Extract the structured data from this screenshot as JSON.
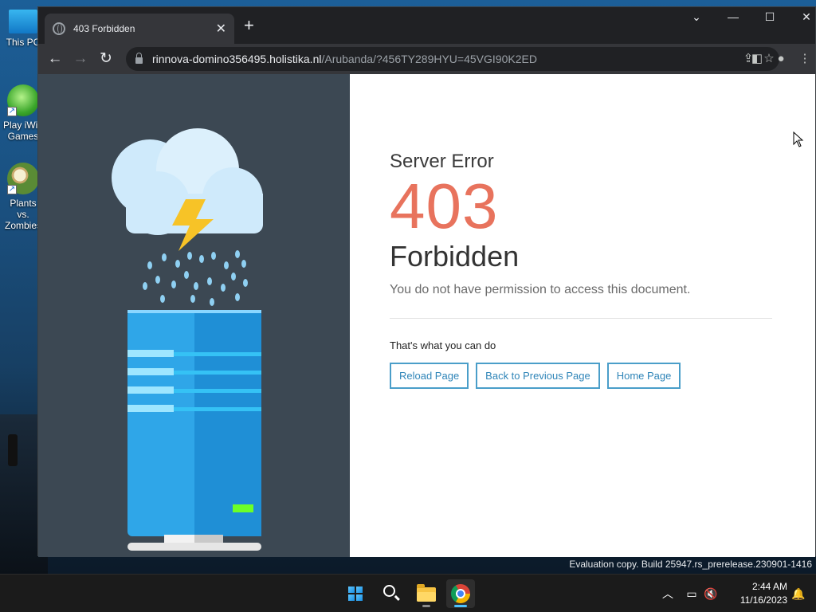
{
  "desktop": {
    "icons": [
      {
        "label": "This PC"
      },
      {
        "label": "Play iWin Games"
      },
      {
        "label": "Plants vs. Zombies"
      }
    ]
  },
  "browser": {
    "tab": {
      "title": "403 Forbidden"
    },
    "window_controls": {
      "dropdown": "⌄",
      "minimize": "—",
      "maximize": "☐",
      "close": "✕"
    },
    "omnibox": {
      "host": "rinnova-domino356495.holistika.nl",
      "path": "/Arubanda/?456TY289HYU=45VGI90K2ED"
    }
  },
  "page": {
    "error_label": "Server Error",
    "error_code": "403",
    "error_title": "Forbidden",
    "error_message": "You do not have permission to access this document.",
    "suggestion": "That's what you can do",
    "buttons": {
      "reload": "Reload Page",
      "back": "Back to Previous Page",
      "home": "Home Page"
    },
    "colors": {
      "error_code": "#e8735d",
      "panel_bg": "#3c4853",
      "button_border": "#4a9ec9"
    }
  },
  "watermark": "Evaluation copy. Build 25947.rs_prerelease.230901-1416",
  "taskbar": {
    "apps": [
      "start-icon",
      "search-icon",
      "file-explorer-icon",
      "chrome-icon"
    ],
    "clock": {
      "time": "2:44 AM",
      "date": "11/16/2023"
    }
  }
}
